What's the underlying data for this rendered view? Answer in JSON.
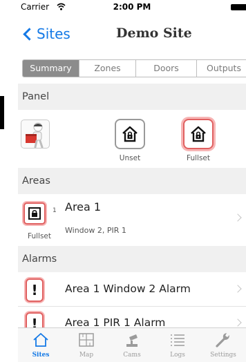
{
  "status_bar": {
    "carrier": "Carrier",
    "time": "2:00 PM"
  },
  "nav": {
    "back_label": "Sites",
    "title": "Demo Site"
  },
  "tabs": [
    {
      "label": "Summary",
      "active": true
    },
    {
      "label": "Zones",
      "active": false
    },
    {
      "label": "Doors",
      "active": false
    },
    {
      "label": "Outputs",
      "active": false
    }
  ],
  "panel": {
    "header": "Panel",
    "unset_label": "Unset",
    "fullset_label": "Fullset",
    "icons": {
      "user": "user-avatar-icon",
      "unset": "house-lock-icon",
      "fullset": "house-lock-icon"
    }
  },
  "areas": {
    "header": "Areas",
    "items": [
      {
        "name": "Area 1",
        "count": "1",
        "state": "Fullset",
        "detail": "Window 2, PIR 1",
        "icon": "padlock-icon"
      }
    ]
  },
  "alarms": {
    "header": "Alarms",
    "items": [
      {
        "mark": "!",
        "text": "Area 1 Window 2 Alarm",
        "icon": "exclamation-icon"
      },
      {
        "mark": "!",
        "text": "Area 1 PIR 1 Alarm",
        "icon": "exclamation-icon"
      }
    ]
  },
  "tab_bar": [
    {
      "label": "Sites",
      "icon": "house-icon",
      "active": true
    },
    {
      "label": "Map",
      "icon": "map-grid-icon",
      "active": false
    },
    {
      "label": "Cams",
      "icon": "camera-icon",
      "active": false
    },
    {
      "label": "Logs",
      "icon": "list-icon",
      "active": false
    },
    {
      "label": "Settings",
      "icon": "wrench-icon",
      "active": false
    }
  ],
  "colors": {
    "accent": "#1479e6",
    "alarm_red": "#e06060",
    "segment_active": "#8c8c8c",
    "section_bg": "#f0f0f0"
  }
}
